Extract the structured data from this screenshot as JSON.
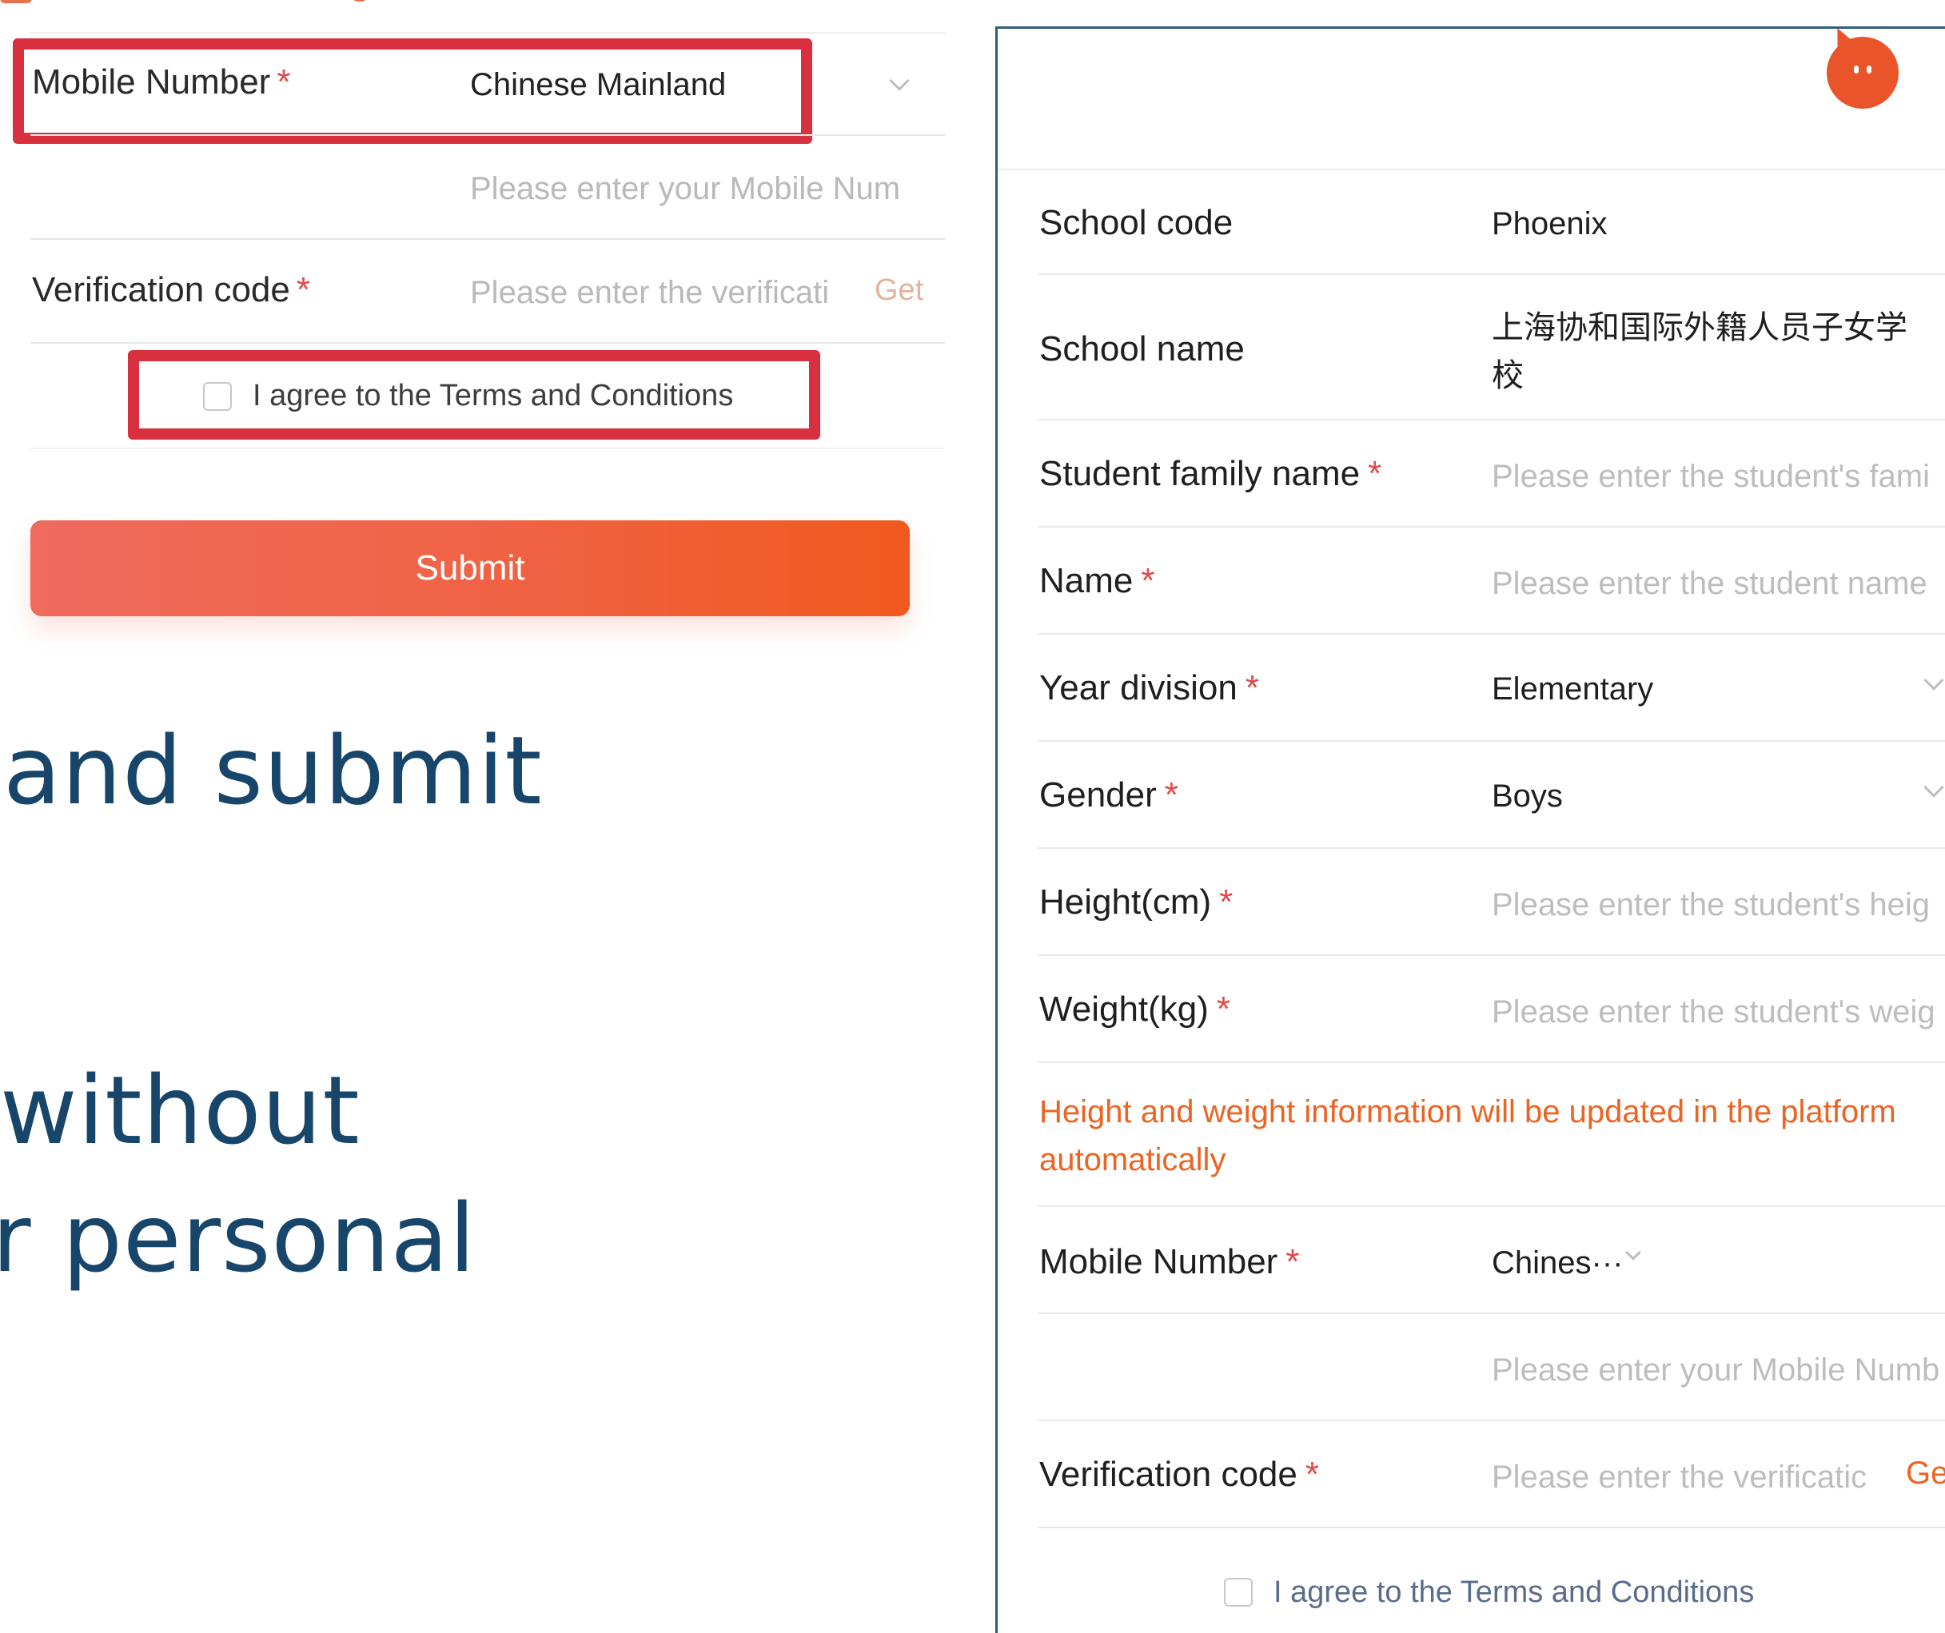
{
  "left_form": {
    "mobile_label": "Mobile Number",
    "required_mark": "*",
    "region_value": "Chinese Mainland",
    "mobile_placeholder": "Please enter your Mobile Num",
    "verification_label": "Verification code",
    "verification_placeholder": "Please enter the verificati",
    "get_code_label": "Get",
    "agree_label": "I agree to the Terms and Conditions",
    "submit_label": "Submit"
  },
  "instruction_text": {
    "line1": "and submit",
    "line2": "without",
    "line3": "r personal"
  },
  "right_form": {
    "required_mark": "*",
    "school_code_label": "School code",
    "school_code_value": "Phoenix",
    "school_name_label": "School name",
    "school_name_value_line1": "上海协和国际外籍人员子女学",
    "school_name_value_line2": "校",
    "family_name_label": "Student family name",
    "family_name_placeholder": "Please enter the student's fami",
    "name_label": "Name",
    "name_placeholder": "Please enter the student name",
    "year_division_label": "Year division",
    "year_division_value": "Elementary",
    "gender_label": "Gender",
    "gender_value": "Boys",
    "height_label": "Height(cm)",
    "height_placeholder": "Please enter the student's heig",
    "weight_label": "Weight(kg)",
    "weight_placeholder": "Please enter the student's weig",
    "note": "Height and weight information will be updated in the platform automatically",
    "mobile_label": "Mobile Number",
    "region_value": "Chines···",
    "mobile_placeholder": "Please enter your Mobile Numb",
    "verification_label": "Verification code",
    "verification_placeholder": "Please enter the verificatic",
    "get_code_label": "Ge",
    "agree_label": "I agree to the Terms and Conditions"
  },
  "colors": {
    "highlight_box": "#d8303e",
    "accent_orange": "#ec6322",
    "required_star": "#e14a4a",
    "heading_blue": "#17466a"
  }
}
